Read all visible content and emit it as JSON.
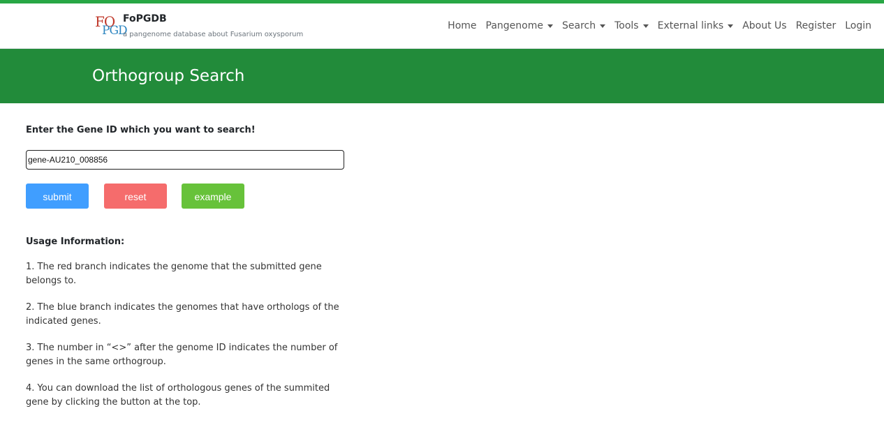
{
  "colors": {
    "top_line": "#28a745",
    "banner": "#228b3a",
    "submit": "#409eff",
    "reset": "#f56c6c",
    "example": "#67c23a"
  },
  "brand": {
    "logo_line1": "FO",
    "logo_line2": "PGD",
    "name": "FoPGDB",
    "tagline": "a pangenome database about Fusarium oxysporum"
  },
  "nav": {
    "home": "Home",
    "pangenome": "Pangenome",
    "search": "Search",
    "tools": "Tools",
    "external_links": "External links",
    "about_us": "About Us",
    "register": "Register",
    "login": "Login"
  },
  "banner": {
    "title": "Orthogroup Search"
  },
  "form": {
    "label": "Enter the Gene ID which you want to search!",
    "gene_id_value": "gene-AU210_008856",
    "submit_label": "submit",
    "reset_label": "reset",
    "example_label": "example"
  },
  "usage": {
    "title": "Usage Information:",
    "items": [
      "1. The red branch indicates the genome that the submitted gene belongs to.",
      "2. The blue branch indicates the genomes that have orthologs of the indicated genes.",
      "3. The number in “<>” after the genome ID indicates the number of genes in the same orthogroup.",
      "4. You can download the list of orthologous genes of the summited gene by clicking the button at the top."
    ]
  }
}
